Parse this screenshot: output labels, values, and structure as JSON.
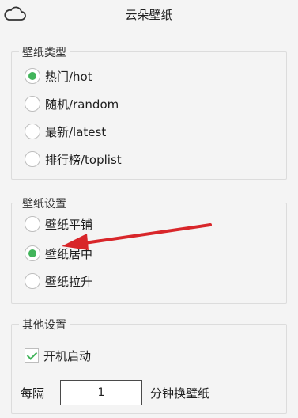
{
  "window": {
    "title": "云朵壁纸",
    "icon": "cloud-icon"
  },
  "wallpaper_type": {
    "legend": "壁纸类型",
    "options": [
      {
        "label": "热门/hot",
        "checked": true
      },
      {
        "label": "随机/random",
        "checked": false
      },
      {
        "label": "最新/latest",
        "checked": false
      },
      {
        "label": "排行榜/toplist",
        "checked": false
      }
    ]
  },
  "wallpaper_settings": {
    "legend": "壁纸设置",
    "options": [
      {
        "label": "壁纸平铺",
        "checked": false
      },
      {
        "label": "壁纸居中",
        "checked": true
      },
      {
        "label": "壁纸拉升",
        "checked": false
      }
    ]
  },
  "other_settings": {
    "legend": "其他设置",
    "autostart_label": "开机启动",
    "autostart_checked": true,
    "interval_prefix": "每隔",
    "interval_value": "1",
    "interval_suffix": "分钟换壁纸"
  },
  "colors": {
    "accent": "#41b45a",
    "arrow": "#d8262a"
  }
}
